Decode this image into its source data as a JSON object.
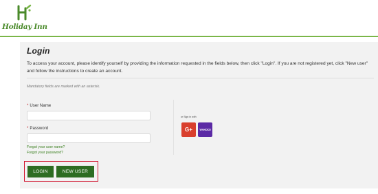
{
  "header": {
    "logo_text": "Holiday Inn",
    "colors": {
      "brand_green": "#4a8a2a",
      "accent_line": "#7ab648"
    }
  },
  "login": {
    "title": "Login",
    "intro": "To access your account, please identify yourself by providing the information requested in the fields below, then click \"Login\". If you are not registered yet, click \"New user\" and follow the instructions to create an account.",
    "mandatory_note": "Mandatory fields are marked with an asterisk.",
    "fields": {
      "username": {
        "label": "User Name",
        "required_marker": "*",
        "value": ""
      },
      "password": {
        "label": "Password",
        "required_marker": "*",
        "value": ""
      }
    },
    "links": {
      "forgot_username": "Forgot your user name?",
      "forgot_password": "Forgot your password?"
    },
    "social": {
      "signin_label": "or Sign in with",
      "google_label": "G+",
      "google_icon": "google-plus-icon",
      "yahoo_label": "YAHOO!",
      "yahoo_icon": "yahoo-icon",
      "colors": {
        "google": "#d93f2d",
        "yahoo": "#5b2aa5"
      }
    },
    "buttons": {
      "login": "LOGIN",
      "new_user": "NEW USER",
      "color": "#2d6c22",
      "highlight_color": "#d0112b"
    }
  }
}
